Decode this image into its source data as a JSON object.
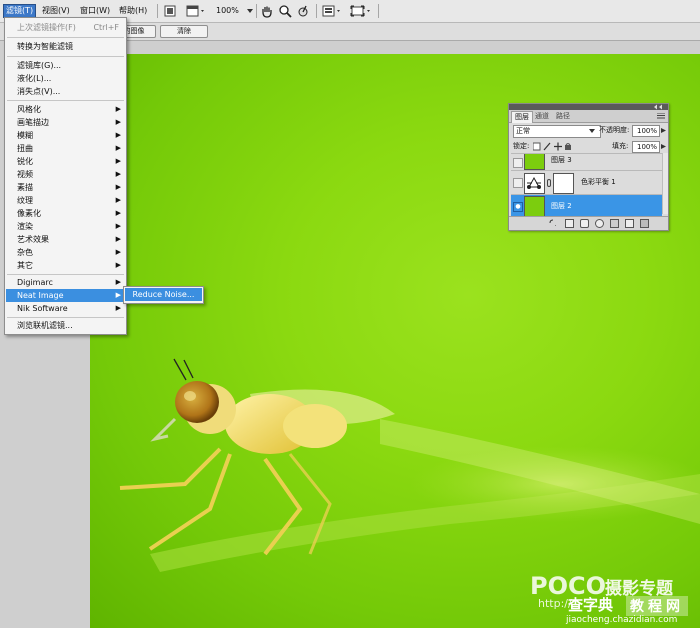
{
  "menubar": {
    "items": [
      {
        "label": "滤镜(T)"
      },
      {
        "label": "视图(V)"
      },
      {
        "label": "窗口(W)"
      },
      {
        "label": "帮助(H)"
      }
    ],
    "zoom": "100%"
  },
  "optbar": {
    "btn1": "的图像",
    "btn2": "清除"
  },
  "filter_menu": {
    "last_filter": "上次滤镜操作(F)",
    "last_filter_shortcut": "Ctrl+F",
    "convert_smart": "转换为智能滤镜",
    "gallery": "滤镜库(G)...",
    "liquify": "液化(L)...",
    "vanishing": "消失点(V)...",
    "groups": [
      "风格化",
      "画笔描边",
      "模糊",
      "扭曲",
      "锐化",
      "视频",
      "素描",
      "纹理",
      "像素化",
      "渲染",
      "艺术效果",
      "杂色",
      "其它"
    ],
    "digimarc": "Digimarc",
    "neat_image": "Neat Image",
    "nik": "Nik Software",
    "browse": "浏览联机滤镜..."
  },
  "submenu": {
    "reduce_noise": "Reduce Noise..."
  },
  "layers_panel": {
    "tabs": [
      "图层",
      "通道",
      "路径"
    ],
    "blend_mode": "正常",
    "opacity_label": "不透明度:",
    "opacity": "100%",
    "lock_label": "锁定:",
    "fill_label": "填充:",
    "fill": "100%",
    "layers": [
      {
        "name": "图层 3"
      },
      {
        "name": "色彩平衡 1"
      },
      {
        "name": "图层 2"
      }
    ]
  },
  "watermark": {
    "brand": "POCO",
    "brand_cn": "摄影专题",
    "url": "http://",
    "site_cn": "查字典",
    "site_cn2": "教程网",
    "site_url": "jiaocheng.chazidian.com"
  },
  "colors": {
    "menu_highlight": "#3b8fe0",
    "layer_selected": "#3a95e6",
    "photo_green": "#8bd910"
  }
}
